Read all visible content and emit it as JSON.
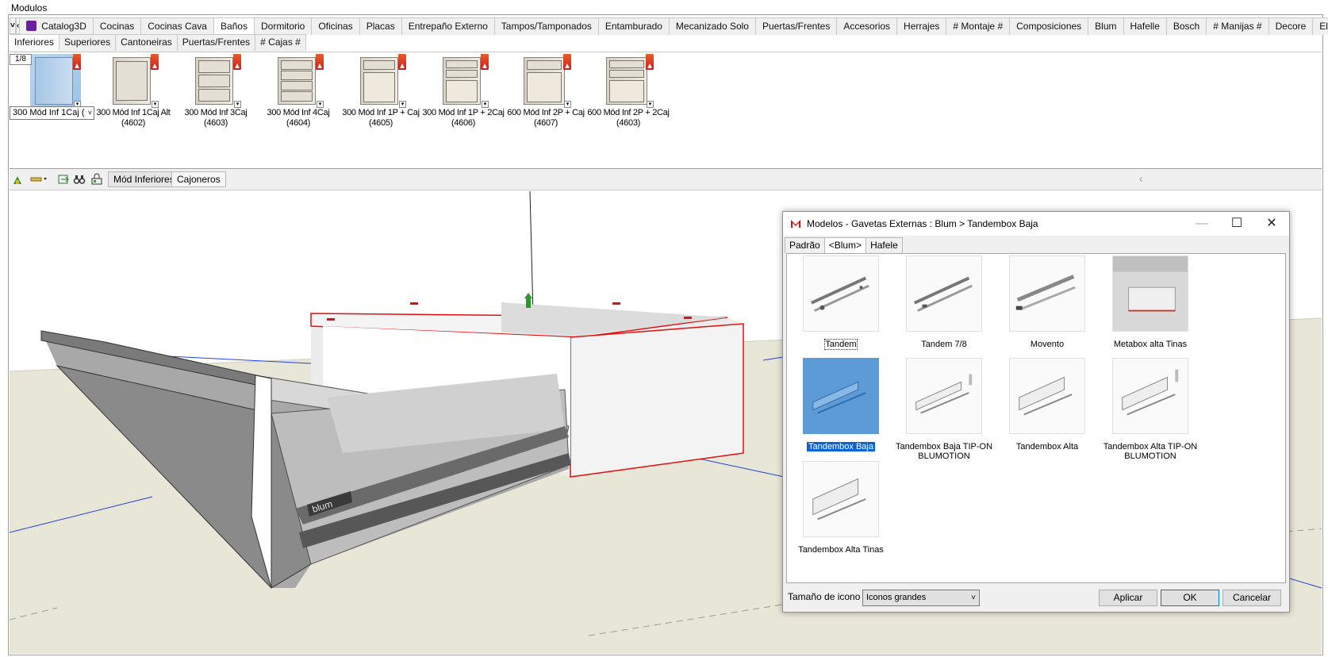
{
  "panel_title": "Modulos",
  "library_tabs": {
    "nav_down": "˅",
    "nav_left": "‹",
    "nav_right": "›",
    "items": [
      "Catalog3D",
      "Cocinas",
      "Cocinas Cava",
      "Baños",
      "Dormitorio",
      "Oficinas",
      "Placas",
      "Entrepaño Externo",
      "Tampos/Tamponados",
      "Entamburado",
      "Mecanizado Solo",
      "Puertas/Frentes",
      "Accesorios",
      "Herrajes",
      "# Montaje #",
      "Composiciones",
      "Blum",
      "Hafelle",
      "Bosch",
      "# Manijas #",
      "Decore",
      "Electrolux"
    ],
    "active": "Baños"
  },
  "sub_tabs": {
    "items": [
      "Inferiores",
      "Superiores",
      "Cantoneiras",
      "Puertas/Frentes",
      "# Cajas #"
    ],
    "active": "Inferiores"
  },
  "thumbnails": {
    "counter": "1/8",
    "selected_value": "300 Mód Inf 1Caj (",
    "items": [
      {
        "label": ""
      },
      {
        "label": "300 Mód Inf 1Caj Alt (4602)"
      },
      {
        "label": "300 Mód Inf 3Caj (4603)"
      },
      {
        "label": "300 Mód Inf 4Caj (4604)"
      },
      {
        "label": "300 Mód Inf 1P + Caj (4605)"
      },
      {
        "label": "300 Mód Inf 1P + 2Caj (4606)"
      },
      {
        "label": "600 Mód Inf 2P + Caj (4607)"
      },
      {
        "label": "600 Mód Inf 2P + 2Caj (4603)"
      }
    ]
  },
  "toolbar": {
    "tabs": [
      "Mód Inferiores",
      "Cajoneros"
    ],
    "scroll_arrow": "‹"
  },
  "dialog": {
    "title": "Modelos - Gavetas Externas : Blum > Tandembox Baja",
    "minimize": "—",
    "maximize": "☐",
    "close": "✕",
    "tabs": [
      "Padrão",
      "<Blum>",
      "Hafele"
    ],
    "active_tab": "<Blum>",
    "items": [
      {
        "label": "Tandem"
      },
      {
        "label": "Tandem 7/8"
      },
      {
        "label": "Movento"
      },
      {
        "label": "Metabox alta Tinas"
      },
      {
        "label": "Tandembox Baja"
      },
      {
        "label": "Tandembox Baja TIP-ON BLUMOTION"
      },
      {
        "label": "Tandembox Alta"
      },
      {
        "label": "Tandembox Alta TIP-ON BLUMOTION"
      },
      {
        "label": "Tandembox Alta Tinas"
      }
    ],
    "selected_item": "Tandembox Baja",
    "icon_size_label": "Tamaño de icono",
    "icon_size_value": "Iconos grandes",
    "apply": "Aplicar",
    "ok": "OK",
    "cancel": "Cancelar"
  },
  "colors": {
    "accent": "#0a64d7",
    "selection_highlight": "#5c9bd6",
    "edge_red": "#e01010",
    "ground": "#e8e6d6"
  }
}
